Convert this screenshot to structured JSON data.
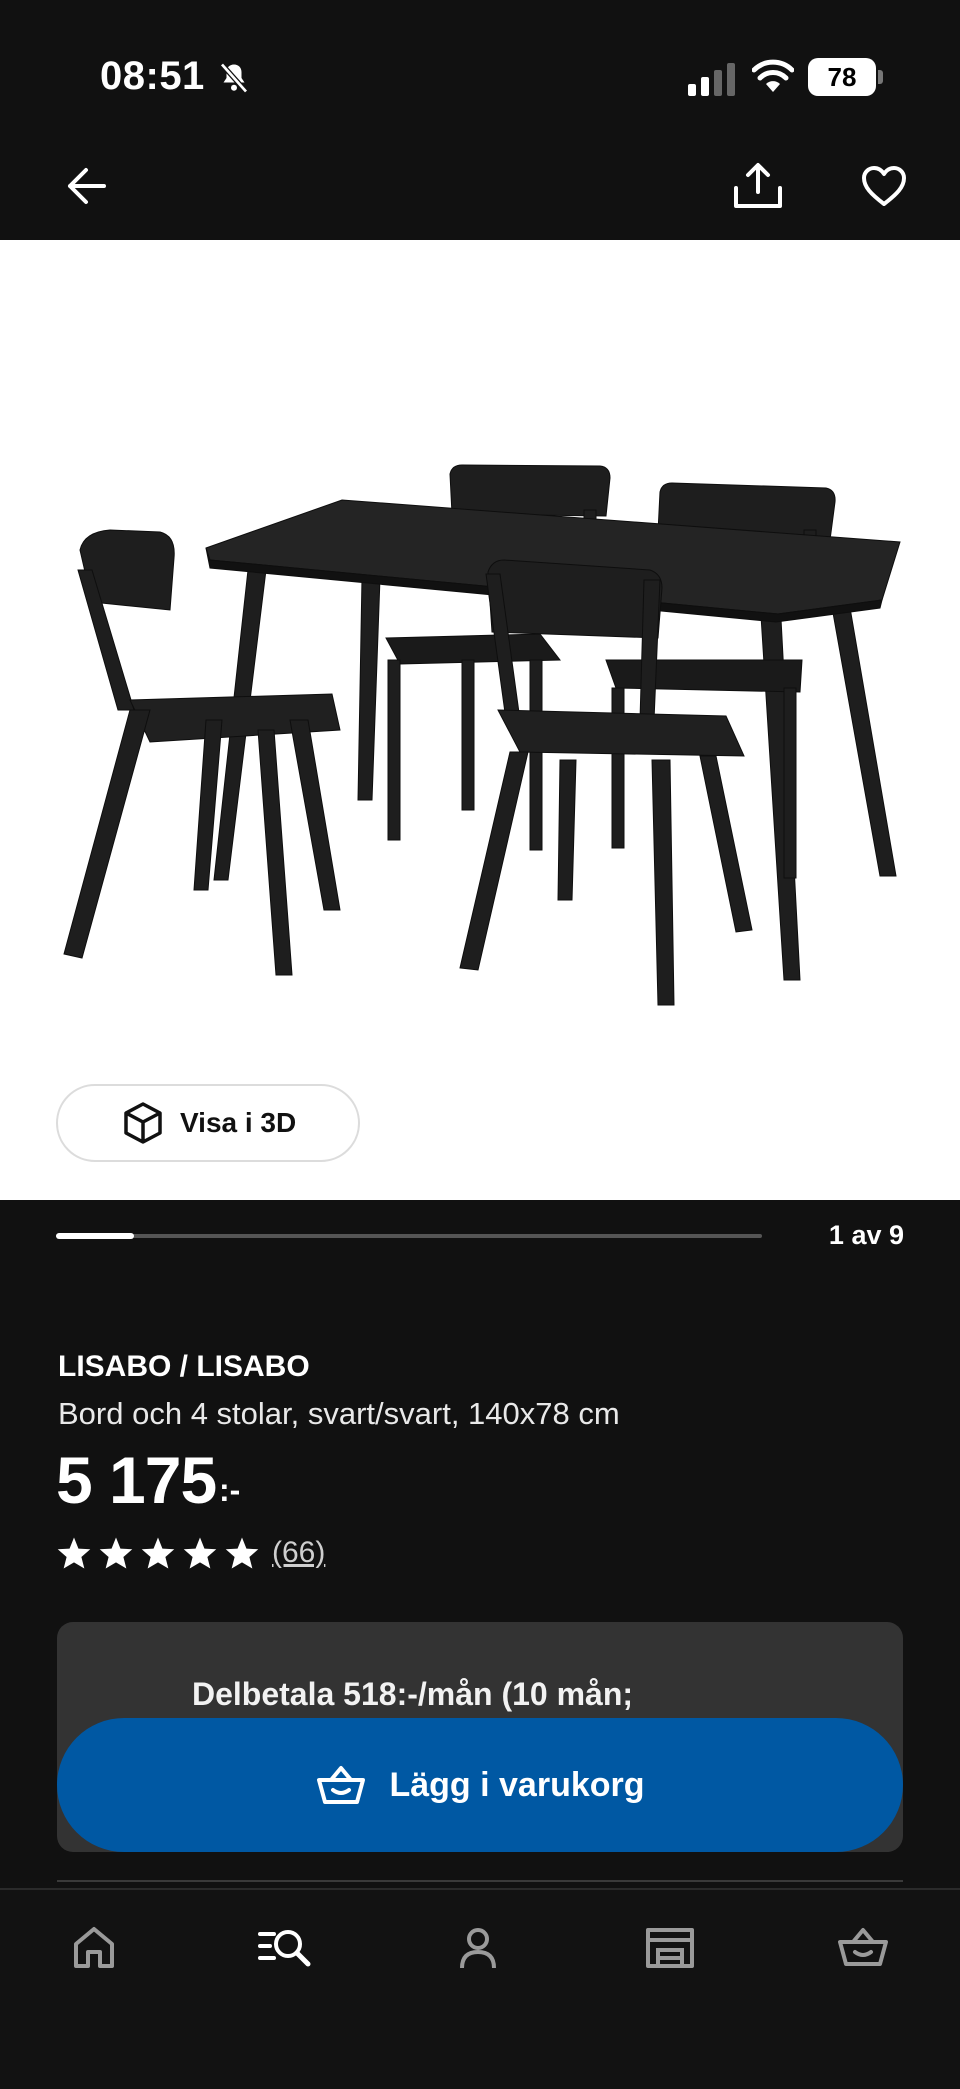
{
  "status_bar": {
    "time": "08:51",
    "battery": "78"
  },
  "nav": {
    "icons": [
      "back-arrow-icon",
      "share-icon",
      "heart-icon"
    ]
  },
  "gallery": {
    "button_label": "Visa i 3D",
    "counter": "1 av 9",
    "progress": 0.11
  },
  "product": {
    "name": "LISABO / LISABO",
    "description": "Bord och 4 stolar, svart/svart, 140x78 cm",
    "price": "5 175",
    "price_suffix": ":-",
    "rating_stars": 5,
    "reviews_count": "(66)"
  },
  "purchase": {
    "installment_text": "Delbetala 518:-/mån (10 mån;",
    "add_to_cart_label": "Lägg i varukorg",
    "accent_color": "#0058a3"
  },
  "tabbar": {
    "items": [
      "home-icon",
      "search-icon",
      "profile-icon",
      "store-icon",
      "cart-icon"
    ]
  }
}
